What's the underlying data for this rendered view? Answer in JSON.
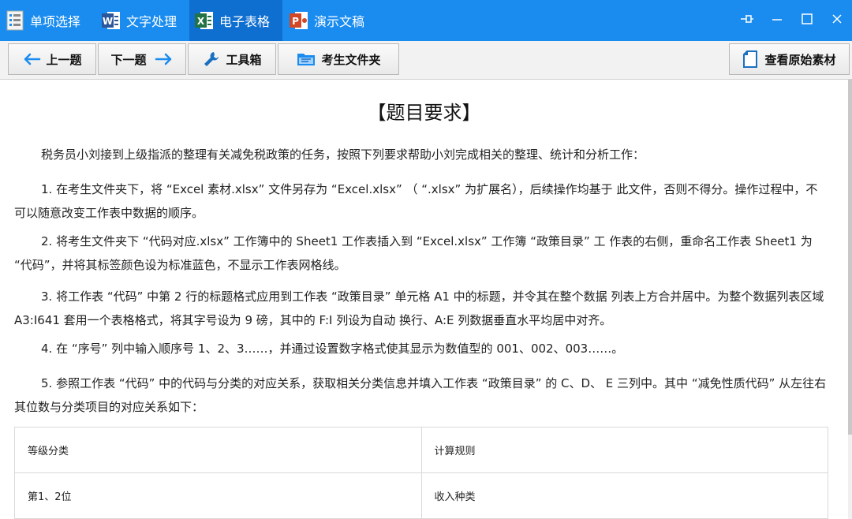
{
  "titlebar": {
    "tabs": [
      {
        "label": "单项选择",
        "icon": "list-icon"
      },
      {
        "label": "文字处理",
        "icon": "word-icon"
      },
      {
        "label": "电子表格",
        "icon": "excel-icon"
      },
      {
        "label": "演示文稿",
        "icon": "powerpoint-icon"
      }
    ],
    "active_tab": "电子表格",
    "icon_letters": {
      "word": "W",
      "excel": "X",
      "ppt": "P"
    },
    "colors": {
      "bar": "#1a8cf0",
      "active": "#0f6fd1",
      "word": "#2b579a",
      "excel": "#217346",
      "ppt": "#d24726"
    }
  },
  "toolbar": {
    "prev_label": "上一题",
    "next_label": "下一题",
    "tools_label": "工具箱",
    "folder_label": "考生文件夹",
    "view_source_label": "查看原始素材"
  },
  "content": {
    "heading": "【题目要求】",
    "intro": "税务员小刘接到上级指派的整理有关减免税政策的任务，按照下列要求帮助小刘完成相关的整理、统计和分析工作：",
    "items": [
      "1. 在考生文件夹下，将 “Excel 素材.xlsx” 文件另存为 “Excel.xlsx” （ “.xlsx” 为扩展名），后续操作均基于 此文件，否则不得分。操作过程中，不可以随意改变工作表中数据的顺序。",
      "2. 将考生文件夹下 “代码对应.xlsx” 工作簿中的 Sheet1 工作表插入到 “Excel.xlsx” 工作簿 “政策目录” 工 作表的右侧，重命名工作表 Sheet1 为 “代码”，并将其标签颜色设为标准蓝色，不显示工作表网格线。",
      "3. 将工作表 “代码” 中第 2 行的标题格式应用到工作表 “政策目录” 单元格 A1 中的标题，并令其在整个数据 列表上方合并居中。为整个数据列表区域 A3:I641 套用一个表格格式，将其字号设为 9 磅，其中的 F:I 列设为自动 换行、A:E 列数据垂直水平均居中对齐。",
      "4. 在 “序号” 列中输入顺序号 1、2、3……，并通过设置数字格式使其显示为数值型的 001、002、003……。",
      "5. 参照工作表 “代码” 中的代码与分类的对应关系，获取相关分类信息并填入工作表 “政策目录” 的 C、D、 E 三列中。其中 “减免性质代码” 从左往右其位数与分类项目的对应关系如下："
    ],
    "table": {
      "headers": [
        "等级分类",
        "计算规则"
      ],
      "rows": [
        [
          "第1、2位",
          "收入种类"
        ]
      ]
    }
  }
}
